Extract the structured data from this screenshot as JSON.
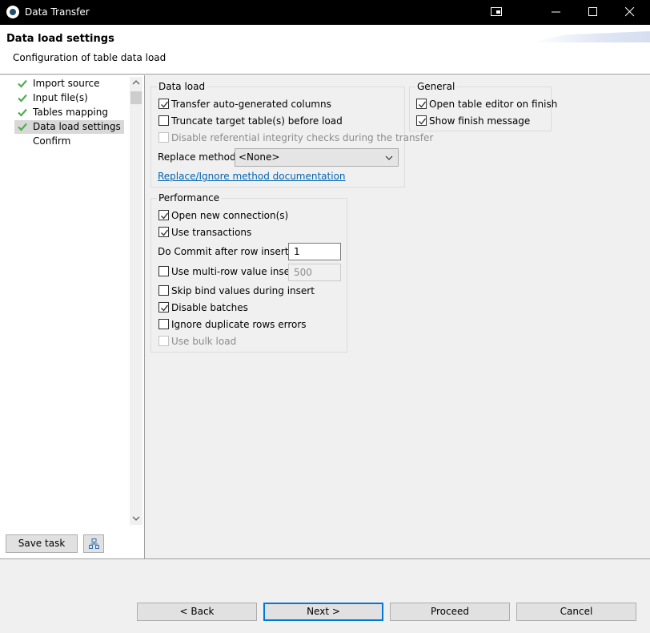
{
  "window": {
    "title": "Data Transfer",
    "controls": [
      "detach-icon",
      "minimize-icon",
      "maximize-icon",
      "close-icon"
    ]
  },
  "header": {
    "title": "Data load settings",
    "description": "Configuration of table data load"
  },
  "nav": {
    "items": [
      {
        "label": "Import source",
        "done": true,
        "selected": false
      },
      {
        "label": "Input file(s)",
        "done": true,
        "selected": false
      },
      {
        "label": "Tables mapping",
        "done": true,
        "selected": false
      },
      {
        "label": "Data load settings",
        "done": true,
        "selected": true
      },
      {
        "label": "Confirm",
        "done": false,
        "selected": false
      }
    ],
    "save_task_label": "Save task",
    "tasks_icon": "task-config-icon"
  },
  "data_load": {
    "legend": "Data load",
    "transfer_auto_generated": {
      "label": "Transfer auto-generated columns",
      "checked": true
    },
    "truncate_target": {
      "label": "Truncate target table(s) before load",
      "checked": false
    },
    "disable_ref_integrity": {
      "label": "Disable referential integrity checks during the transfer",
      "checked": false,
      "enabled": false
    },
    "replace_method_label": "Replace method:",
    "replace_method_value": "<None>",
    "doc_link": "Replace/Ignore method documentation"
  },
  "general": {
    "legend": "General",
    "open_table_editor": {
      "label": "Open table editor on finish",
      "checked": true
    },
    "show_finish_message": {
      "label": "Show finish message",
      "checked": true
    }
  },
  "performance": {
    "legend": "Performance",
    "open_new_connection": {
      "label": "Open new connection(s)",
      "checked": true
    },
    "use_transactions": {
      "label": "Use transactions",
      "checked": true
    },
    "commit_label": "Do Commit after row insert:",
    "commit_value": "1",
    "multi_row": {
      "label": "Use multi-row value insert",
      "checked": false
    },
    "multi_row_value": "500",
    "skip_bind": {
      "label": "Skip bind values during insert",
      "checked": false
    },
    "disable_batches": {
      "label": "Disable batches",
      "checked": true
    },
    "ignore_duplicates": {
      "label": "Ignore duplicate rows errors",
      "checked": false
    },
    "use_bulk_load": {
      "label": "Use bulk load",
      "checked": false,
      "enabled": false
    }
  },
  "footer": {
    "back": "< Back",
    "next": "Next >",
    "proceed": "Proceed",
    "cancel": "Cancel"
  },
  "colors": {
    "check_green": "#4caf50",
    "link_blue": "#0063b1",
    "focus_blue": "#0078d7"
  }
}
